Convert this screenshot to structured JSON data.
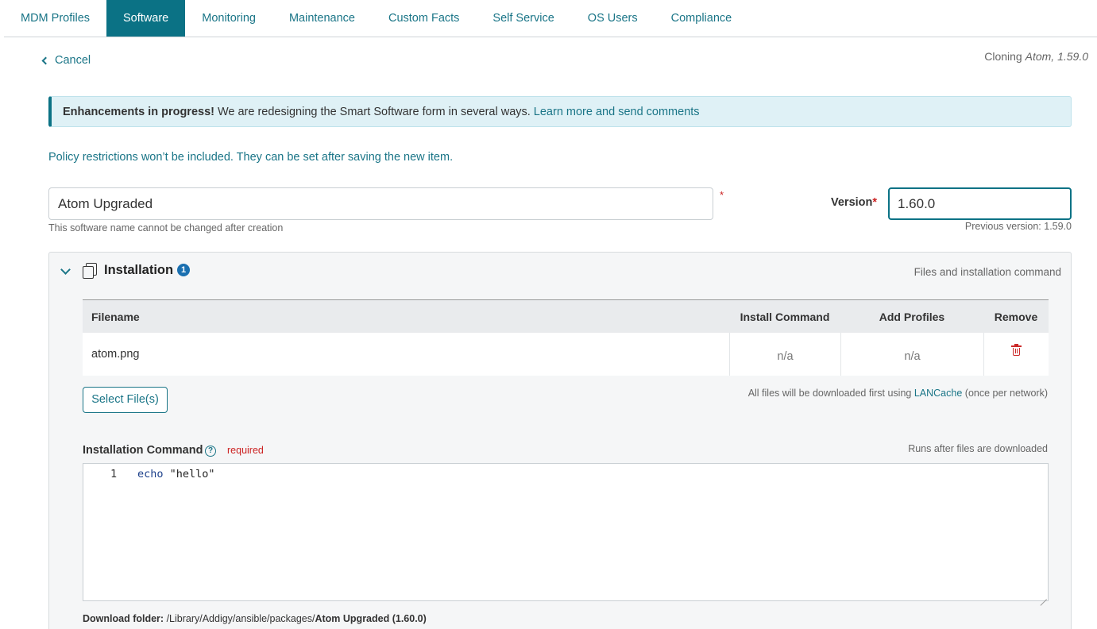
{
  "tabs": [
    {
      "label": "MDM Profiles",
      "active": false
    },
    {
      "label": "Software",
      "active": true
    },
    {
      "label": "Monitoring",
      "active": false
    },
    {
      "label": "Maintenance",
      "active": false
    },
    {
      "label": "Custom Facts",
      "active": false
    },
    {
      "label": "Self Service",
      "active": false
    },
    {
      "label": "OS Users",
      "active": false
    },
    {
      "label": "Compliance",
      "active": false
    }
  ],
  "header": {
    "cancel_label": "Cancel",
    "cloning_prefix": "Cloning",
    "cloning_name": "Atom, 1.59.0"
  },
  "banner": {
    "bold": "Enhancements in progress!",
    "text": "We are redesigning the Smart Software form in several ways.",
    "link": "Learn more and send comments"
  },
  "policy_note": "Policy restrictions won’t be included. They can be set after saving the new item.",
  "form": {
    "name_value": "Atom Upgraded",
    "name_required_mark": "*",
    "name_hint": "This software name cannot be changed after creation",
    "version_label": "Version",
    "version_required_mark": "*",
    "version_value": "1.60.0",
    "version_hint": "Previous version: 1.59.0"
  },
  "installation": {
    "title": "Installation",
    "count": "1",
    "subtitle": "Files and installation command",
    "columns": {
      "filename": "Filename",
      "install_command": "Install Command",
      "add_profiles": "Add Profiles",
      "remove": "Remove"
    },
    "files": [
      {
        "filename": "atom.png",
        "install_command": "n/a",
        "add_profiles": "n/a"
      }
    ],
    "select_files_label": "Select File(s)",
    "lan_note_prefix": "All files will be downloaded first using",
    "lan_note_link": "LANCache",
    "lan_note_suffix": "(once per network)",
    "command_label": "Installation Command",
    "help_glyph": "?",
    "required_label": "required",
    "runs_note": "Runs after files are downloaded",
    "editor": {
      "line_number": "1",
      "keyword": "echo",
      "argument": " \"hello\""
    },
    "download_label": "Download folder:",
    "download_path": "/Library/Addigy/ansible/packages/",
    "download_folder": "Atom Upgraded (1.60.0)"
  },
  "colors": {
    "accent": "#0b7285",
    "link": "#1a7587",
    "danger": "#cc2222",
    "badge": "#1a6fb0"
  },
  "icons": [
    "chevron-left-icon",
    "chevron-down-icon",
    "copy-files-icon",
    "help-icon",
    "trash-icon"
  ]
}
